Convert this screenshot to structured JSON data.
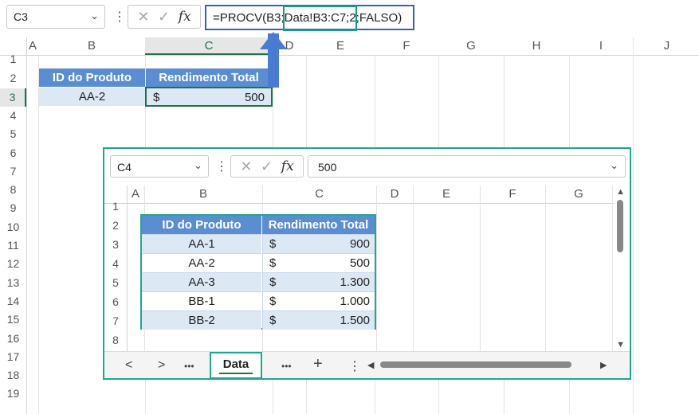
{
  "top": {
    "name_box": "C3",
    "formula_prefix": "=PROCV(B3",
    "formula_range": ";Data!B3:C7",
    "formula_suffix": ";2;FALSO)",
    "columns": [
      "A",
      "B",
      "C",
      "D",
      "E",
      "F",
      "G",
      "H",
      "I",
      "J"
    ],
    "rows": [
      "1",
      "2",
      "3",
      "4",
      "5",
      "6",
      "7",
      "8",
      "9",
      "10",
      "11",
      "12",
      "13",
      "14",
      "15",
      "16",
      "17",
      "18",
      "19"
    ],
    "table": {
      "headers": [
        "ID do Produto",
        "Rendimento Total"
      ],
      "row": {
        "id": "AA-2",
        "currency": "$",
        "value": "500"
      }
    }
  },
  "data_window": {
    "name_box": "C4",
    "formula_value": "500",
    "columns": [
      "A",
      "B",
      "C",
      "D",
      "E",
      "F",
      "G"
    ],
    "rows": [
      "1",
      "2",
      "3",
      "4",
      "5",
      "6",
      "7",
      "8"
    ],
    "table": {
      "headers": [
        "ID do Produto",
        "Rendimento Total"
      ],
      "rows": [
        {
          "id": "AA-1",
          "currency": "$",
          "value": "900"
        },
        {
          "id": "AA-2",
          "currency": "$",
          "value": "500"
        },
        {
          "id": "AA-3",
          "currency": "$",
          "value": "1.300"
        },
        {
          "id": "BB-1",
          "currency": "$",
          "value": "1.000"
        },
        {
          "id": "BB-2",
          "currency": "$",
          "value": "1.500"
        }
      ]
    },
    "sheet_tab": "Data",
    "nav": {
      "prev": "<",
      "next": ">",
      "more": "•••",
      "add": "+",
      "options": "⋮"
    }
  },
  "colors": {
    "header_fill": "#5b8ed1",
    "alt_row": "#dde8f5",
    "highlight": "#1fa88f",
    "formula_border": "#3a5fb8"
  },
  "icons": {
    "cancel": "✕",
    "enter": "✓",
    "fx": "fx",
    "dropdown": "⌄"
  }
}
